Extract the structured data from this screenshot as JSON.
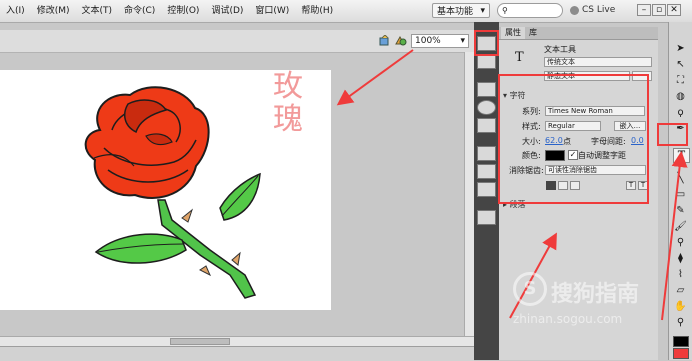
{
  "menu": {
    "items": [
      "入(I)",
      "修改(M)",
      "文本(T)",
      "命令(C)",
      "控制(O)",
      "调试(D)",
      "窗口(W)",
      "帮助(H)"
    ],
    "workspace": "基本功能",
    "cs_live": "CS Live"
  },
  "stage": {
    "zoom": "100%",
    "text_chars": [
      "玫",
      "瑰"
    ]
  },
  "properties": {
    "tabs": [
      "属性",
      "库"
    ],
    "tool_name": "文本工具",
    "text_engine": "传统文本",
    "text_type": "静态文本",
    "char_section": "字符",
    "family_label": "系列:",
    "family_value": "Times New Roman",
    "style_label": "样式:",
    "style_value": "Regular",
    "embed_button": "嵌入...",
    "size_label": "大小:",
    "size_value": "62.0",
    "size_unit": "点",
    "letter_spacing_label": "字母间距:",
    "letter_spacing_value": "0.0",
    "color_label": "颜色:",
    "auto_kern_label": "自动调整字距",
    "aa_label": "消除锯齿:",
    "aa_value": "可读性消除锯齿",
    "para_section": "段落"
  },
  "watermark": {
    "logo_text": "搜狗指南",
    "url": "zhinan.sogou.com"
  },
  "colors": {
    "highlight": "#ef3b3b",
    "petal": "#ee3a17",
    "leaf": "#3fbf3f",
    "text_pink": "#f29a9a"
  }
}
